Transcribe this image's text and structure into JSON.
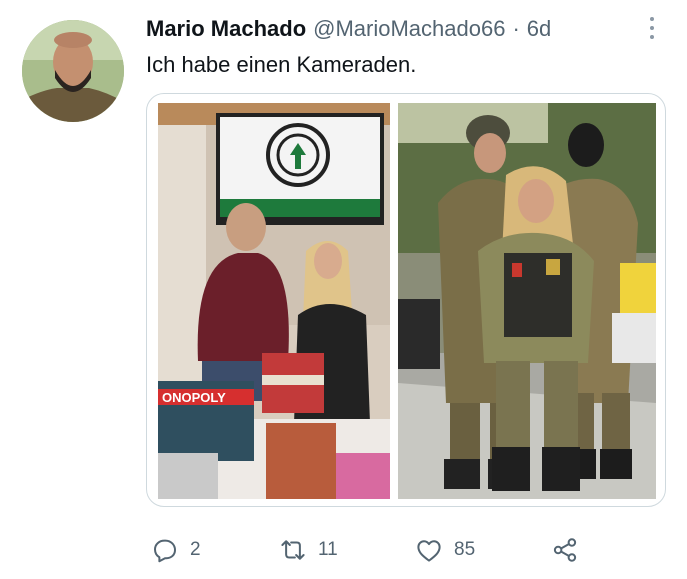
{
  "author": {
    "name": "Mario Machado",
    "handle": "@MarioMachado66",
    "separator": "·",
    "time": "6d"
  },
  "tweet": {
    "text": "Ich habe einen Kameraden."
  },
  "media": {
    "left_photo": {
      "game_box_text": "ONOPOLY"
    }
  },
  "actions": {
    "reply_count": "2",
    "retweet_count": "11",
    "like_count": "85"
  },
  "colors": {
    "text_primary": "#0f1419",
    "text_secondary": "#536471",
    "border": "#cfd9de",
    "flag_green": "#1e7a3c"
  },
  "icons": [
    "more-icon",
    "reply-icon",
    "retweet-icon",
    "like-icon",
    "share-icon"
  ]
}
